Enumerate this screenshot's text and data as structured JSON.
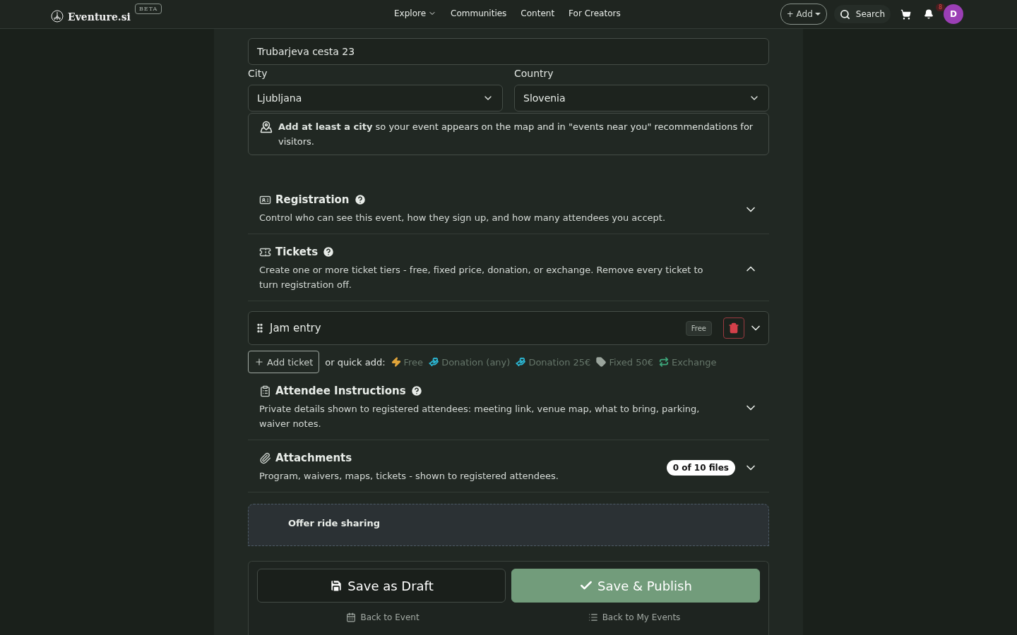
{
  "header": {
    "logo": "Eventure.si",
    "badge": "BETA",
    "nav": [
      {
        "label": "Explore",
        "dropdown": true
      },
      {
        "label": "Communities",
        "dropdown": false
      },
      {
        "label": "Content",
        "dropdown": false
      },
      {
        "label": "For Creators",
        "dropdown": false
      }
    ],
    "add_button": "+ Add",
    "search": "Search",
    "notifications": "8",
    "avatar": "D"
  },
  "address": {
    "value": "Trubarjeva cesta 23"
  },
  "location_fields": [
    {
      "label": "City",
      "value": "Ljubljana"
    },
    {
      "label": "Country",
      "value": "Slovenia"
    }
  ],
  "hint": "**Add at least a city** so your event appears on the map and in \"events near you\" recommendations for visitors.",
  "sections": [
    {
      "kind": "registration",
      "title": "Registration",
      "help": true,
      "description": "Control who can see this event, how they sign up, and how many attendees you accept.",
      "expanded": false
    },
    {
      "kind": "tickets",
      "title": "Tickets",
      "help": true,
      "description": "Create one or more ticket tiers - free, fixed price, donation, or exchange. Remove every ticket to turn registration off.",
      "expanded": true,
      "tickets": [
        {
          "name": "Jam entry",
          "price_tag": "Free",
          "expanded": false
        }
      ],
      "add_ticket": "Add ticket",
      "quick_add_label": "or quick add:",
      "quick_add": [
        {
          "kind": "free",
          "label": "Free",
          "color": "#e0a43a"
        },
        {
          "kind": "donation",
          "label": "Donation (any)",
          "color": "#2cb9d6"
        },
        {
          "kind": "donation",
          "label": "Donation 25€",
          "color": "#2cb9d6"
        },
        {
          "kind": "fixed",
          "label": "Fixed 50€",
          "color": "#9ba59d"
        },
        {
          "kind": "exchange",
          "label": "Exchange",
          "color": "#3ea77c"
        }
      ]
    },
    {
      "kind": "instructions",
      "title": "Attendee Instructions",
      "help": true,
      "description": "Private details shown to registered attendees: meeting link, venue map, what to bring, parking, waiver notes.",
      "expanded": false
    },
    {
      "kind": "attachments",
      "title": "Attachments",
      "help": false,
      "count": "0 of 10 files",
      "description": "Program, waivers, maps, tickets - shown to registered attendees.",
      "expanded": false
    }
  ],
  "ride_sharing": {
    "title": "Offer ride sharing"
  },
  "actions": {
    "draft": "Save as Draft",
    "publish": "Save & Publish",
    "links": [
      {
        "kind": "event",
        "label": "Back to Event"
      },
      {
        "kind": "list",
        "label": "Back to My Events"
      }
    ]
  }
}
